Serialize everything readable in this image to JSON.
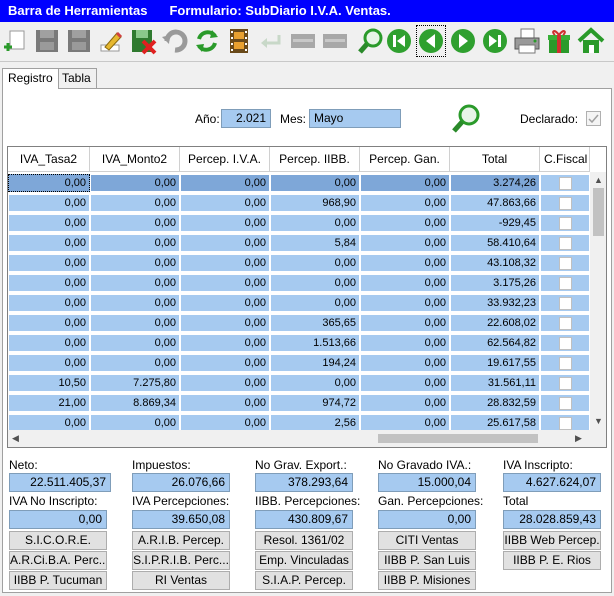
{
  "title": {
    "toolbar_name": "Barra de Herramientas",
    "form_name": "Formulario: SubDiario I.V.A. Ventas."
  },
  "toolbar": {
    "icons": [
      "add-icon",
      "save-icon",
      "save-disabled-icon",
      "edit-icon",
      "delete-icon",
      "undo-icon",
      "refresh-icon",
      "film-icon",
      "return-icon",
      "blank-icon",
      "blank-icon",
      "search-icon",
      "first-icon",
      "prev-icon",
      "next-icon",
      "last-icon",
      "print-icon",
      "gift-icon",
      "home-icon"
    ]
  },
  "tabs": [
    {
      "label": "Registro",
      "active": true
    },
    {
      "label": "Tabla",
      "active": false
    }
  ],
  "filters": {
    "year_label": "Año:",
    "year_value": "2.021",
    "month_label": "Mes:",
    "month_value": "Mayo",
    "declared_label": "Declarado:",
    "declared_checked": true
  },
  "grid": {
    "columns": [
      "IVA_Tasa2",
      "IVA_Monto2",
      "Percep. I.V.A.",
      "Percep. IIBB.",
      "Percep. Gan.",
      "Total",
      "C.Fiscal"
    ],
    "rows": [
      [
        "0,00",
        "0,00",
        "0,00",
        "0,00",
        "0,00",
        "3.274,26"
      ],
      [
        "0,00",
        "0,00",
        "0,00",
        "968,90",
        "0,00",
        "47.863,66"
      ],
      [
        "0,00",
        "0,00",
        "0,00",
        "0,00",
        "0,00",
        "-929,45"
      ],
      [
        "0,00",
        "0,00",
        "0,00",
        "5,84",
        "0,00",
        "58.410,64"
      ],
      [
        "0,00",
        "0,00",
        "0,00",
        "0,00",
        "0,00",
        "43.108,32"
      ],
      [
        "0,00",
        "0,00",
        "0,00",
        "0,00",
        "0,00",
        "3.175,26"
      ],
      [
        "0,00",
        "0,00",
        "0,00",
        "0,00",
        "0,00",
        "33.932,23"
      ],
      [
        "0,00",
        "0,00",
        "0,00",
        "365,65",
        "0,00",
        "22.608,02"
      ],
      [
        "0,00",
        "0,00",
        "0,00",
        "1.513,66",
        "0,00",
        "62.564,82"
      ],
      [
        "0,00",
        "0,00",
        "0,00",
        "194,24",
        "0,00",
        "19.617,55"
      ],
      [
        "10,50",
        "7.275,80",
        "0,00",
        "0,00",
        "0,00",
        "31.561,11"
      ],
      [
        "21,00",
        "8.869,34",
        "0,00",
        "974,72",
        "0,00",
        "28.832,59"
      ],
      [
        "0,00",
        "0,00",
        "0,00",
        "2,56",
        "0,00",
        "25.617,58"
      ]
    ]
  },
  "totals": {
    "neto": {
      "label": "Neto:",
      "value": "22.511.405,37"
    },
    "impuestos": {
      "label": "Impuestos:",
      "value": "26.076,66"
    },
    "no_grav_export": {
      "label": "No Grav. Export.:",
      "value": "378.293,64"
    },
    "no_gravado_iva": {
      "label": "No Gravado IVA.:",
      "value": "15.000,04"
    },
    "iva_inscripto": {
      "label": "IVA Inscripto:",
      "value": "4.627.624,07"
    },
    "iva_no_inscripto": {
      "label": "IVA No Inscripto:",
      "value": "0,00"
    },
    "iva_percepciones": {
      "label": "IVA Percepciones:",
      "value": "39.650,08"
    },
    "iibb_percepciones": {
      "label": "IIBB. Percepciones:",
      "value": "430.809,67"
    },
    "gan_percepciones": {
      "label": "Gan. Percepciones:",
      "value": "0,00"
    },
    "total": {
      "label": "Total",
      "value": "28.028.859,43"
    }
  },
  "buttons": {
    "sicore": "S.I.C.O.R.E.",
    "arib": "A.R.I.B. Percep.",
    "resol": "Resol. 1361/02",
    "citi": "CITI Ventas",
    "iibb_web": "IIBB Web Percep.",
    "arciba": "A.R.Ci.B.A. Perc...",
    "siprib": "S.I.P.R.I.B. Perc...",
    "emp_vinc": "Emp. Vinculadas",
    "iibb_san_luis": "IIBB P. San Luis",
    "iibb_rios": "IIBB P. E. Rios",
    "iibb_tucuman": "IIBB P. Tucuman",
    "ri_ventas": "RI Ventas",
    "siap": "S.I.A.P. Percep.",
    "iibb_misiones": "IIBB P. Misiones"
  },
  "colors": {
    "titlebar": "#0000ff",
    "field": "#a6caf0",
    "current_row": "#7ea7d8"
  }
}
